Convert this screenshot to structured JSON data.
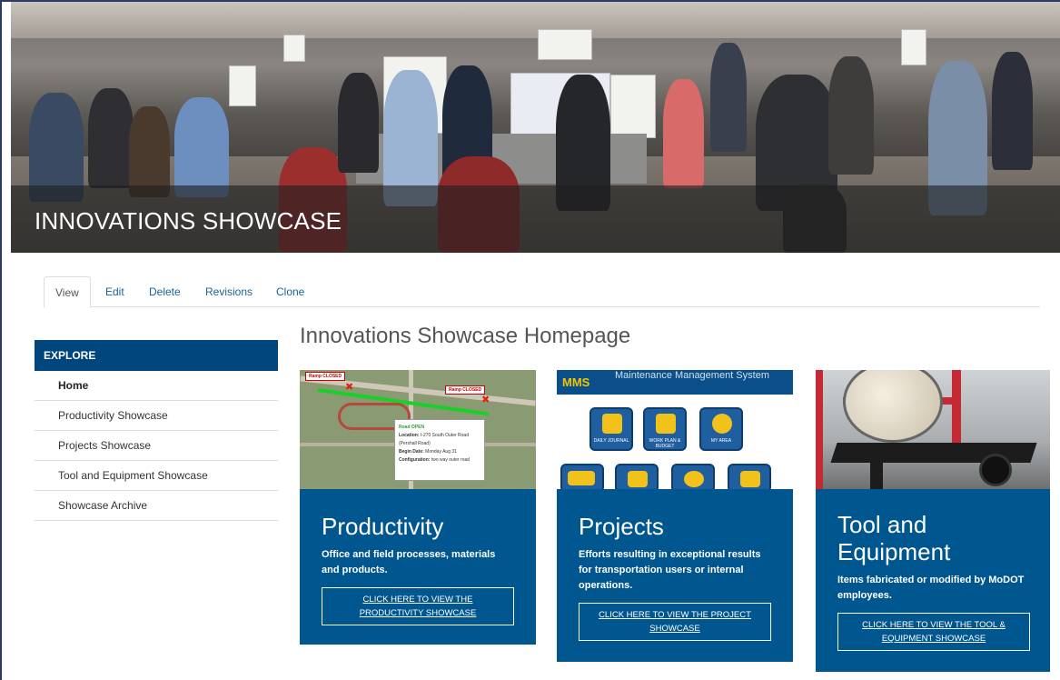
{
  "hero": {
    "title": "INNOVATIONS SHOWCASE"
  },
  "tabs": [
    {
      "label": "View",
      "active": true
    },
    {
      "label": "Edit",
      "active": false
    },
    {
      "label": "Delete",
      "active": false
    },
    {
      "label": "Revisions",
      "active": false
    },
    {
      "label": "Clone",
      "active": false
    }
  ],
  "sidebar": {
    "heading": "EXPLORE",
    "items": [
      {
        "label": "Home",
        "current": true
      },
      {
        "label": "Productivity Showcase",
        "current": false
      },
      {
        "label": "Projects Showcase",
        "current": false
      },
      {
        "label": "Tool and Equipment Showcase",
        "current": false
      },
      {
        "label": "Showcase Archive",
        "current": false
      }
    ]
  },
  "main": {
    "title": "Innovations Showcase Homepage",
    "cards": [
      {
        "title": "Productivity",
        "description": "Office and field processes, materials and products.",
        "button": "CLICK HERE TO VIEW THE PRODUCTIVITY SHOWCASE",
        "map": {
          "tag_left": "Ramp CLOSED",
          "tag_right": "Ramp CLOSED",
          "popup_status": "Road OPEN",
          "popup_location_label": "Location:",
          "popup_location": "I-270 South Outer Road (Pershall Road)",
          "popup_begin_label": "Begin Date:",
          "popup_begin": "Monday Aug 31",
          "popup_config_label": "Configuration:",
          "popup_config": "two way outer road"
        }
      },
      {
        "title": "Projects",
        "description": "Efforts resulting in exceptional results for transportation users or internal operations.",
        "button": "CLICK HERE TO VIEW THE PROJECT SHOWCASE",
        "mms": {
          "logo": "MMS",
          "header": "Maintenance Management System",
          "tiles": [
            "DAILY JOURNAL",
            "WORK PLAN & BUDGET",
            "MY AREA"
          ]
        }
      },
      {
        "title": "Tool and Equipment",
        "description": "Items fabricated or modified by MoDOT employees.",
        "button": "CLICK HERE TO VIEW THE TOOL & EQUIPMENT SHOWCASE"
      }
    ]
  },
  "colors": {
    "brand_blue": "#00457c",
    "card_blue": "#00568f",
    "link_blue": "#1a6496",
    "map_route": "#19d02a"
  }
}
